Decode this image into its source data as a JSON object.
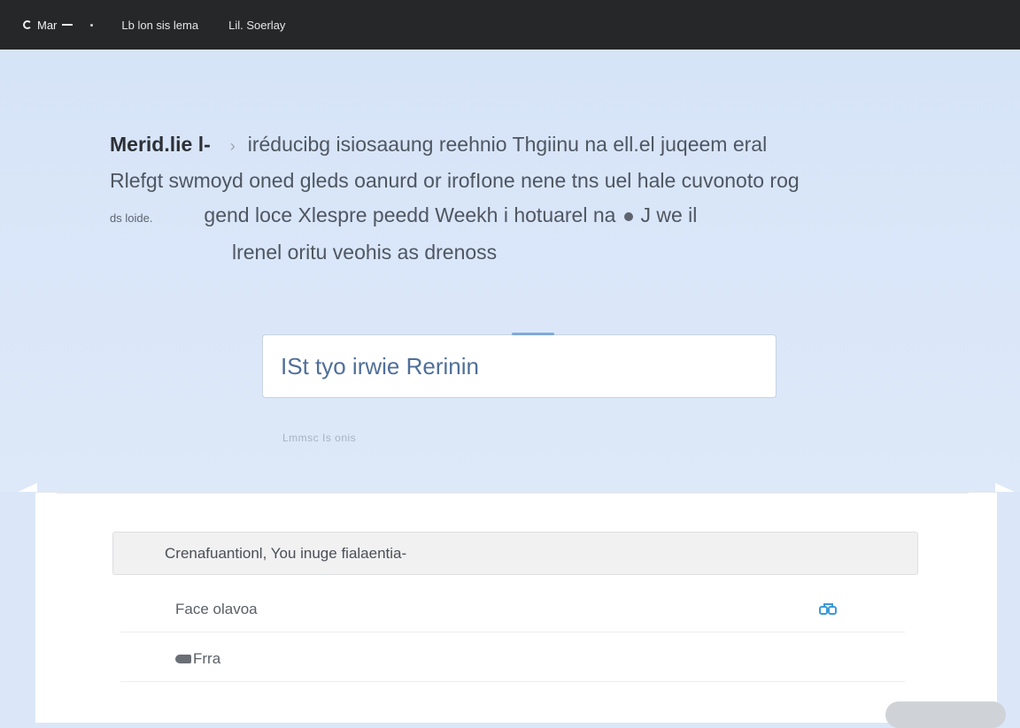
{
  "topbar": {
    "brand_label": "Mar",
    "nav": [
      {
        "label": "Lb lon sis lema"
      },
      {
        "label": "Lil. Soerlay"
      }
    ]
  },
  "hero": {
    "line1_lead": "Merid.lie l-",
    "line1_text": "iréducibg isiosaaung reehnio Thgiinu na ell.el juqeem eral",
    "line2_text": "Rlefgt swmoyd oned gleds oanurd or irofIone nene tns uel hale cuvonoto rog",
    "line3_lead": "ds loide.",
    "line3_text_a": "gend loce Xlespre peedd Weekh i hotuarel na",
    "line3_text_b": "J we il",
    "line4_text": "lrenel oritu veohis as drenoss"
  },
  "search": {
    "placeholder": "ISt tyo irwie Rerinin",
    "value": ""
  },
  "hint": {
    "text": "Lmmsc Is onis"
  },
  "results": {
    "header": "Crenafuantionl, You inuge fialaentia-",
    "items": [
      {
        "label": "Face olavoa",
        "action_icon": "link-icon"
      },
      {
        "label": "Frra",
        "action_icon": null
      }
    ]
  },
  "colors": {
    "topbar_bg": "#262729",
    "hero_bg": "#dbe7f8",
    "accent": "#4a86c8",
    "action_icon": "#3a9ad9"
  }
}
